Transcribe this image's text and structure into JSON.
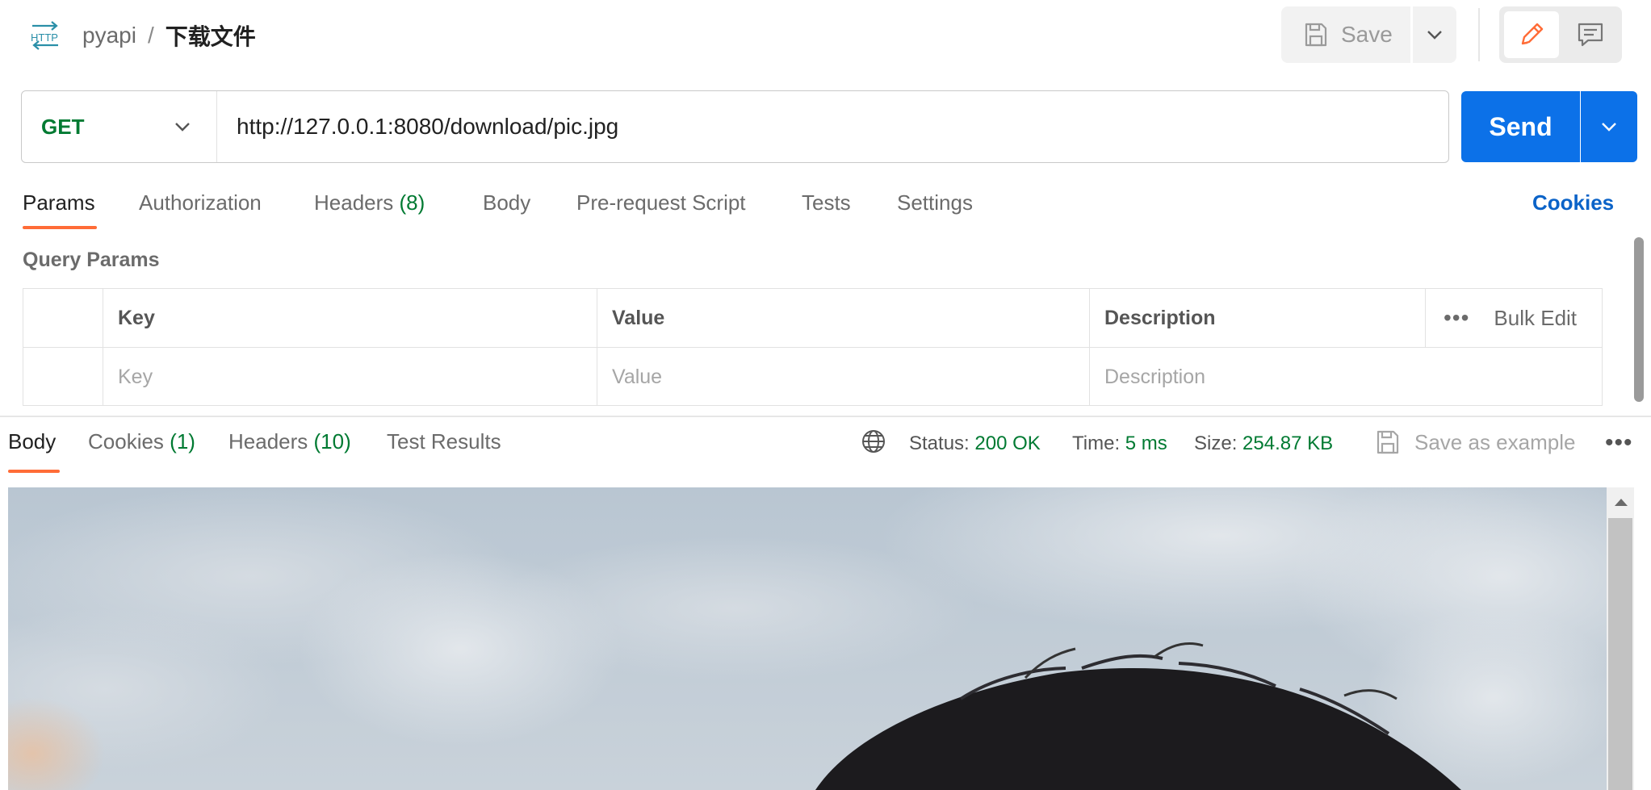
{
  "header": {
    "icon": "http-icon",
    "collection": "pyapi",
    "separator": "/",
    "request_name": "下载文件",
    "save_label": "Save"
  },
  "request": {
    "method": "GET",
    "url": "http://127.0.0.1:8080/download/pic.jpg",
    "send_label": "Send"
  },
  "request_tabs": [
    {
      "label": "Params",
      "active": true
    },
    {
      "label": "Authorization"
    },
    {
      "label": "Headers",
      "count": "(8)"
    },
    {
      "label": "Body"
    },
    {
      "label": "Pre-request Script"
    },
    {
      "label": "Tests"
    },
    {
      "label": "Settings"
    }
  ],
  "cookies_link": "Cookies",
  "query_params": {
    "title": "Query Params",
    "headers": [
      "Key",
      "Value",
      "Description"
    ],
    "bulk_edit": "Bulk Edit",
    "placeholders": [
      "Key",
      "Value",
      "Description"
    ]
  },
  "response": {
    "tabs": [
      {
        "label": "Body",
        "active": true
      },
      {
        "label": "Cookies",
        "count": "(1)"
      },
      {
        "label": "Headers",
        "count": "(10)"
      },
      {
        "label": "Test Results"
      }
    ],
    "status_label": "Status:",
    "status_value": "200 OK",
    "time_label": "Time:",
    "time_value": "5 ms",
    "size_label": "Size:",
    "size_value": "254.87 KB",
    "save_example": "Save as example",
    "more": "•••"
  },
  "colors": {
    "accent_orange": "#ff6c37",
    "send_blue": "#0c71e8",
    "success_green": "#007a32",
    "link_blue": "#0b63c8"
  }
}
